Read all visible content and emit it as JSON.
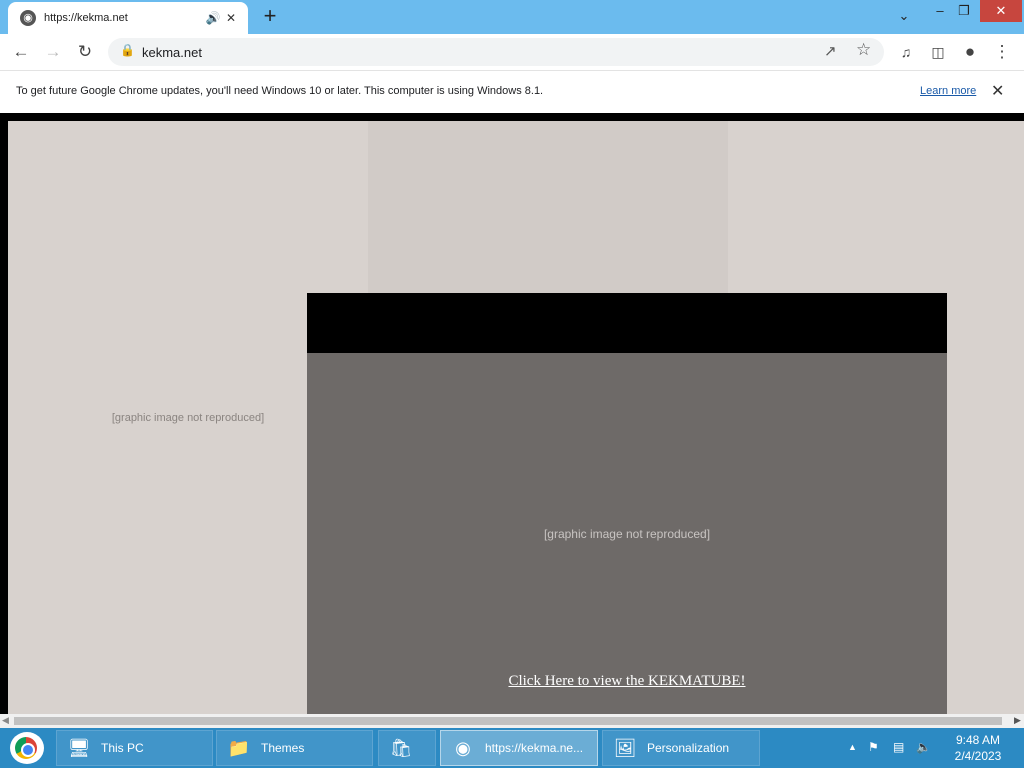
{
  "browser": {
    "tab": {
      "title": "https://kekma.net",
      "favicon": "globe-icon"
    },
    "address": {
      "url": "kekma.net"
    }
  },
  "infobar": {
    "message": "To get future Google Chrome updates, you'll need Windows 10 or later. This computer is using Windows 8.1.",
    "link": "Learn more"
  },
  "page": {
    "link_text": "Click Here to view the KEKMATUBE!",
    "placeholders": {
      "background": "[graphic image not reproduced]",
      "popup": "[graphic image not reproduced]"
    }
  },
  "taskbar": {
    "items": [
      {
        "label": "This PC",
        "icon": "monitor-icon"
      },
      {
        "label": "Themes",
        "icon": "folder-icon"
      },
      {
        "label": "",
        "icon": "store-icon"
      },
      {
        "label": "https://kekma.ne...",
        "icon": "chrome-icon"
      },
      {
        "label": "Personalization",
        "icon": "personalization-icon"
      }
    ],
    "clock": {
      "time": "9:48 AM",
      "date": "2/4/2023"
    }
  }
}
